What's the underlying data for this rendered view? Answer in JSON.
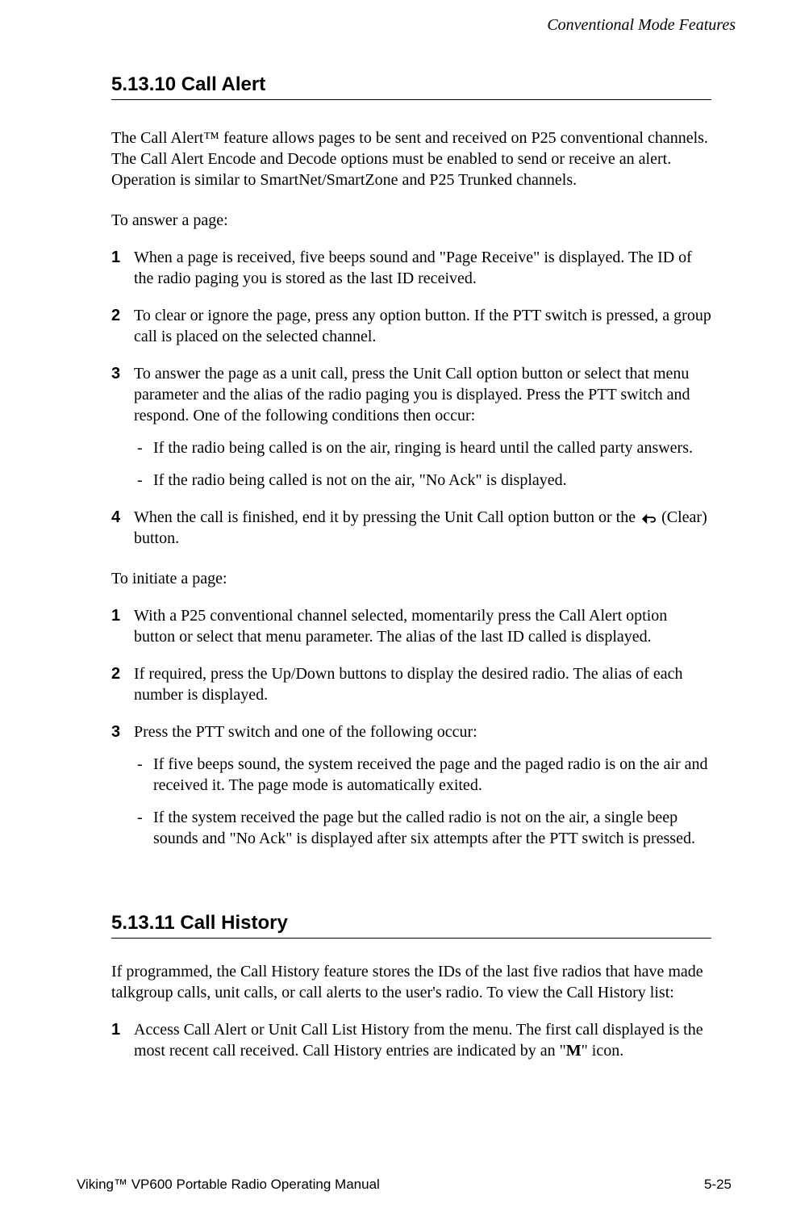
{
  "header": {
    "chapter": "Conventional Mode Features"
  },
  "section1": {
    "number": "5.13.10",
    "title": "Call Alert",
    "intro": "The Call Alert™ feature allows pages to be sent and received on P25 conventional channels. The Call Alert Encode and Decode options must be enabled to send or receive an alert. Operation is similar to SmartNet/SmartZone and P25 Trunked channels.",
    "answer_label": "To answer a page:",
    "answer_steps": [
      "When a page is received, five beeps sound and \"Page Receive\" is displayed. The ID of the radio paging you is stored as the last ID received.",
      "To clear or ignore the page, press any option button. If the PTT switch is pressed, a group call is placed on the selected channel.",
      "To answer the page as a unit call, press the Unit Call option button or select that menu parameter and the alias of the radio paging you is displayed. Press the PTT switch and respond. One of the following conditions then occur:"
    ],
    "answer_step3_dashes": [
      "If the radio being called is on the air, ringing is heard until the called party answers.",
      "If the radio being called is not on the air, \"No Ack\" is displayed."
    ],
    "answer_step4_pre": "When the call is finished, end it by pressing the Unit Call option button or the ",
    "answer_step4_post": " (Clear) button.",
    "initiate_label": "To initiate a page:",
    "initiate_steps": [
      "With a P25 conventional channel selected, momentarily press the Call Alert option button or select that menu parameter. The alias of the last ID called is displayed.",
      "If required, press the Up/Down buttons to display the desired radio. The alias of each number is displayed.",
      "Press the PTT switch and one of the following occur:"
    ],
    "initiate_step3_dashes": [
      "If five beeps sound, the system received the page and the paged radio is on the air and received it. The page mode is automatically exited.",
      "If the system received the page but the called radio is not on the air, a single beep sounds and \"No Ack\" is displayed after six attempts after the PTT switch is pressed."
    ]
  },
  "section2": {
    "number": "5.13.11",
    "title": "Call History",
    "intro": "If programmed, the Call History feature stores the IDs of the last five radios that have made talkgroup calls, unit calls, or call alerts to the user's radio. To view the Call History list:",
    "step1_pre": "Access Call Alert or Unit Call List History from the menu. The first call displayed is the most recent call received. Call History entries are indicated by an \"",
    "step1_bold": "M",
    "step1_post": "\" icon."
  },
  "footer": {
    "left": "Viking™ VP600 Portable Radio Operating Manual",
    "right": "5-25"
  },
  "nums": {
    "n1": "1",
    "n2": "2",
    "n3": "3",
    "n4": "4"
  },
  "dash": "-"
}
